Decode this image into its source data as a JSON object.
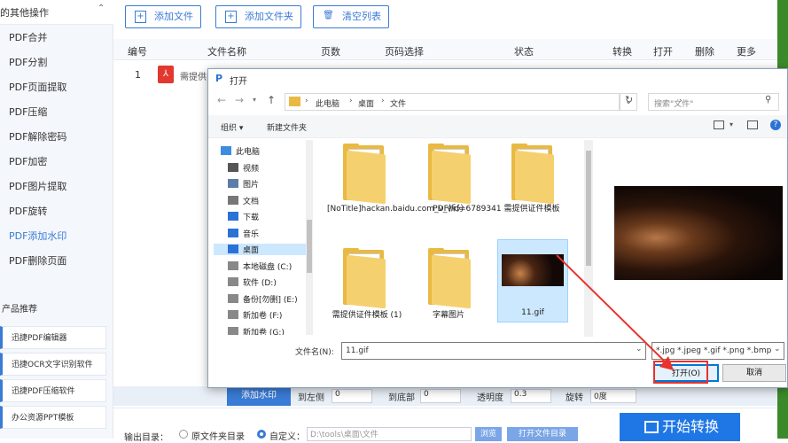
{
  "app": {
    "sidebar": {
      "header": "的其他操作",
      "items": [
        "PDF合并",
        "PDF分割",
        "PDF页面提取",
        "PDF压缩",
        "PDF解除密码",
        "PDF加密",
        "PDF图片提取",
        "PDF旋转",
        "PDF添加水印",
        "PDF删除页面"
      ],
      "active_index": 8,
      "section_title": "产品推荐",
      "products": [
        "迅捷PDF编辑器",
        "迅捷OCR文字识别软件",
        "迅捷PDF压缩软件",
        "办公资源PPT模板"
      ]
    },
    "toolbar": {
      "add_file": "添加文件",
      "add_folder": "添加文件夹",
      "clear_list": "清空列表"
    },
    "table": {
      "headers": [
        "编号",
        "文件名称",
        "页数",
        "页码选择",
        "状态",
        "转换",
        "打开",
        "删除",
        "更多"
      ],
      "row": {
        "num": "1",
        "name": "需提供"
      }
    },
    "settings_row": {
      "add_watermark": "添加水印",
      "left_label": "到左侧",
      "left_val": "0",
      "bottom_label": "到底部",
      "bottom_val": "0",
      "opacity_label": "透明度",
      "opacity_val": "0.3",
      "rotate_label": "旋转",
      "rotate_val": "0度"
    },
    "footer": {
      "output_label": "输出目录：",
      "opt_source": "原文件夹目录",
      "opt_custom": "自定义：",
      "path": "D:\\tools\\桌面\\文件",
      "browse": "浏览",
      "open_folder": "打开文件目录",
      "start": "开始转换"
    }
  },
  "dialog": {
    "title": "打开",
    "breadcrumb": [
      "此电脑",
      "桌面",
      "文件"
    ],
    "search_placeholder": "搜索\"文件\"",
    "organize": "组织 ▾",
    "new_folder": "新建文件夹",
    "tree": [
      "此电脑",
      "视频",
      "图片",
      "文档",
      "下载",
      "音乐",
      "桌面",
      "本地磁盘 (C:)",
      "软件 (D:)",
      "备份[勿删] (E:)",
      "新加卷 (F:)",
      "新加卷 (G:)"
    ],
    "tree_selected": 6,
    "files": [
      {
        "label": "[NoTitle]hackan.baidu.com_v_vid=6789341",
        "type": "folder"
      },
      {
        "label": "PDF拆分",
        "type": "folder"
      },
      {
        "label": "需提供证件模板",
        "type": "folder"
      },
      {
        "label": "需提供证件模板 (1)",
        "type": "folder"
      },
      {
        "label": "字幕图片",
        "type": "folder"
      },
      {
        "label": "11.gif",
        "type": "image",
        "selected": true
      }
    ],
    "filename_label": "文件名(N):",
    "filename_value": "11.gif",
    "filter": "*.jpg *.jpeg *.gif *.png *.bmp",
    "open_button": "打开(O)",
    "cancel_button": "取消"
  },
  "colors": {
    "accent": "#3a7bd5",
    "annotation": "#e8322c",
    "selection": "#cce8ff"
  }
}
